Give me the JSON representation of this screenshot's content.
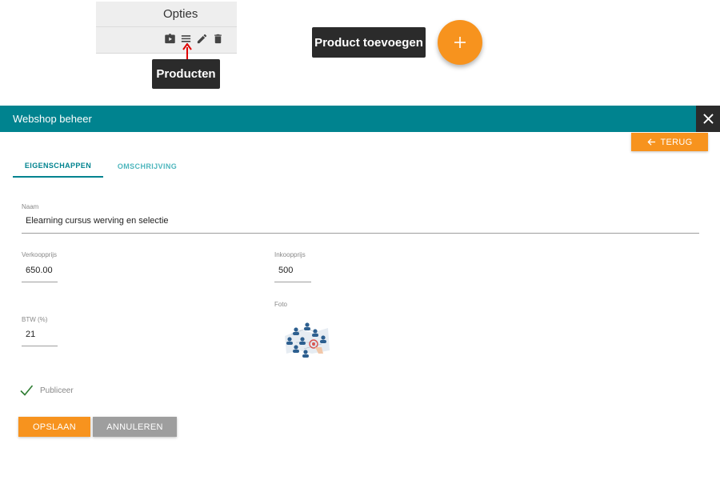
{
  "annotation": {
    "options_title": "Opties",
    "tooltip_products": "Producten",
    "tooltip_add_product": "Product toevoegen",
    "option_icons": [
      "video-icon",
      "list-icon",
      "edit-icon",
      "delete-icon"
    ]
  },
  "dialog": {
    "title": "Webshop beheer",
    "back_label": "TERUG",
    "tabs": [
      {
        "label": "EIGENSCHAPPEN",
        "active": true
      },
      {
        "label": "OMSCHRIJVING",
        "active": false
      }
    ],
    "fields": {
      "naam": {
        "label": "Naam",
        "value": "Elearning cursus werving en selectie"
      },
      "verkoopprijs": {
        "label": "Verkoopprijs",
        "value": "650.00"
      },
      "inkoopprijs": {
        "label": "Inkoopprijs",
        "value": "500"
      },
      "btw": {
        "label": "BTW (%)",
        "value": "21"
      },
      "foto": {
        "label": "Foto"
      }
    },
    "publish": {
      "label": "Publiceer",
      "checked": true
    },
    "buttons": {
      "save": "OPSLAAN",
      "cancel": "ANNULEREN"
    }
  },
  "colors": {
    "header": "#00838f",
    "accent": "#f7931e",
    "tab_active": "#00838f",
    "tab_inactive": "#4db6bd",
    "cancel": "#9e9e9e",
    "check": "#2e7d32"
  }
}
